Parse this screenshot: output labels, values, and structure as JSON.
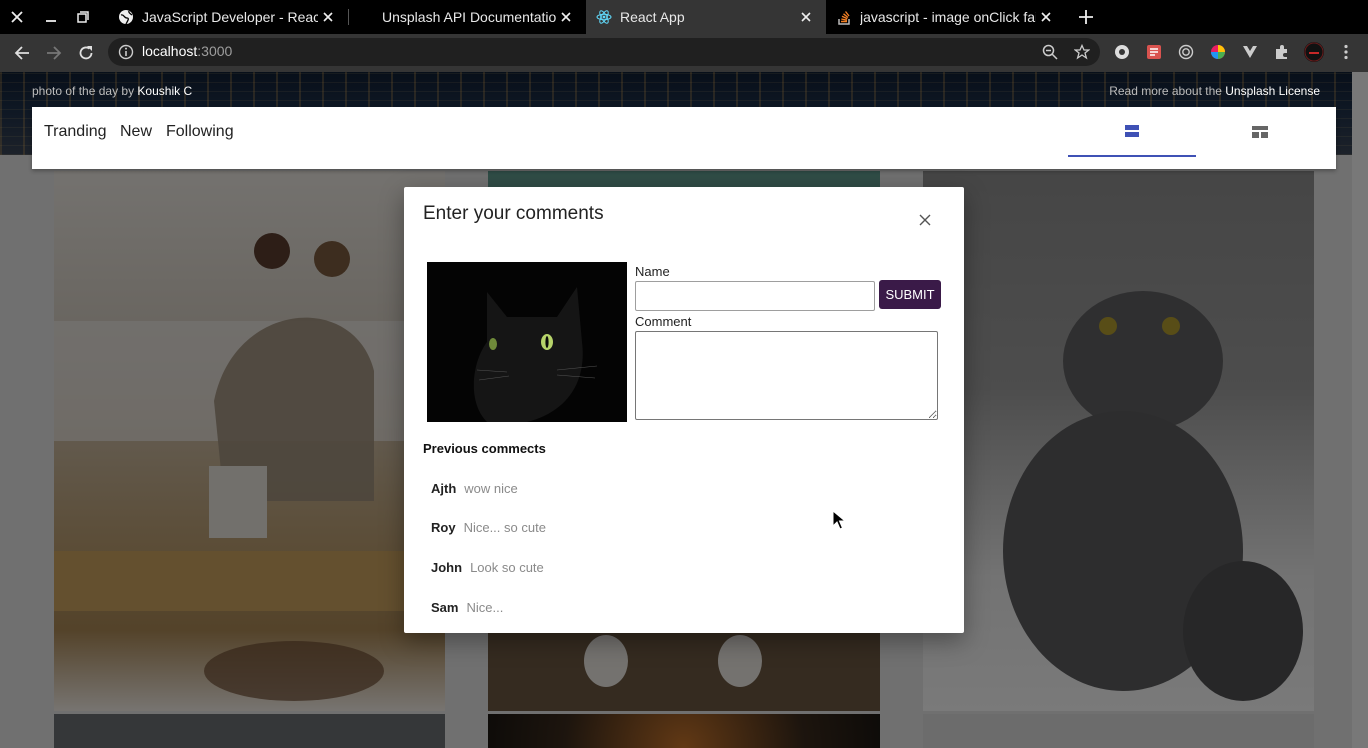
{
  "browser": {
    "tabs": [
      {
        "title": "JavaScript Developer - React.",
        "icon": "globe-icon",
        "active": false
      },
      {
        "title": "Unsplash API Documentation",
        "icon": "unsplash-icon",
        "active": false
      },
      {
        "title": "React App",
        "icon": "react-icon",
        "active": true
      },
      {
        "title": "javascript - image onClick faili",
        "icon": "stackoverflow-icon",
        "active": false
      }
    ],
    "address": {
      "host": "localhost",
      "port": ":3000"
    }
  },
  "page": {
    "credit_left_prefix": "photo of the day by ",
    "credit_left_author": "Koushik C",
    "credit_right_prefix": "Read more about the ",
    "credit_right_link": "Unsplash License",
    "nav": {
      "links": [
        "Tranding",
        "New",
        "Following"
      ]
    }
  },
  "modal": {
    "title": "Enter your comments",
    "name_label": "Name",
    "name_value": "",
    "submit_label": "SUBMIT",
    "comment_label": "Comment",
    "comment_value": "",
    "previous_title": "Previous commects",
    "comments": [
      {
        "author": "Ajth",
        "text": "wow nice"
      },
      {
        "author": "Roy",
        "text": "Nice... so cute"
      },
      {
        "author": "John",
        "text": "Look so cute"
      },
      {
        "author": "Sam",
        "text": "Nice..."
      }
    ]
  },
  "colors": {
    "accent": "#3f51b5",
    "submit_bg": "#3a1a48"
  }
}
